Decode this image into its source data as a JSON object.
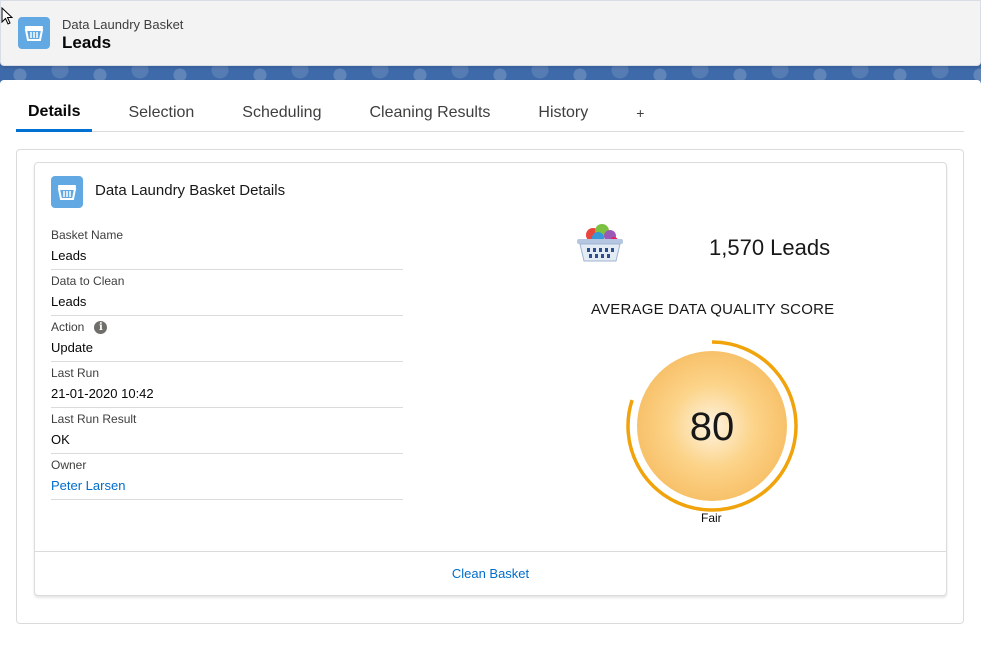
{
  "header": {
    "object_type": "Data Laundry Basket",
    "record_name": "Leads",
    "icon": "basket-icon"
  },
  "tabs": [
    {
      "label": "Details",
      "active": true
    },
    {
      "label": "Selection",
      "active": false
    },
    {
      "label": "Scheduling",
      "active": false
    },
    {
      "label": "Cleaning Results",
      "active": false
    },
    {
      "label": "History",
      "active": false
    },
    {
      "label": "+",
      "active": false
    }
  ],
  "card": {
    "title": "Data Laundry Basket Details",
    "icon": "basket-icon",
    "fields": [
      {
        "label": "Basket Name",
        "value": "Leads"
      },
      {
        "label": "Data to Clean",
        "value": "Leads"
      },
      {
        "label": "Action",
        "value": "Update",
        "info_icon": "i"
      },
      {
        "label": "Last Run",
        "value": "21-01-2020 10:42"
      },
      {
        "label": "Last Run Result",
        "value": "OK"
      },
      {
        "label": "Owner",
        "value": "Peter Larsen"
      }
    ],
    "summary": {
      "count_text": "1,570  Leads"
    },
    "score": {
      "title": "AVERAGE DATA QUALITY SCORE",
      "value": "80",
      "rating": "Fair",
      "fraction": 0.8,
      "ring_color": "#f0a30a"
    },
    "footer_action": "Clean Basket"
  },
  "colors": {
    "brand_blue": "#0070d2",
    "icon_bg": "#62a8e3",
    "link": "#006dcc"
  }
}
